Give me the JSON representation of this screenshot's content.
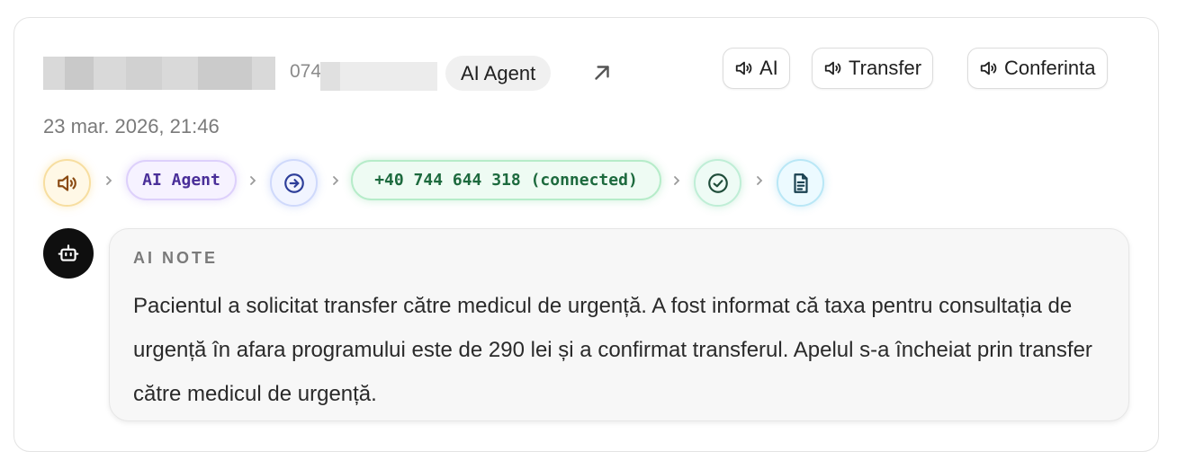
{
  "header": {
    "phone_prefix": "074",
    "agent_label": "AI Agent",
    "external_link_icon": "arrow-up-right-icon",
    "audio_buttons": [
      {
        "label": "AI",
        "icon": "speaker-icon"
      },
      {
        "label": "Transfer",
        "icon": "speaker-icon"
      },
      {
        "label": "Conferinta",
        "icon": "speaker-icon"
      }
    ]
  },
  "date": "23 mar. 2026, 21:46",
  "flow": {
    "steps": [
      {
        "kind": "icon",
        "icon": "speaker-icon",
        "color": "#b06a10"
      },
      {
        "kind": "pill",
        "label": "AI Agent",
        "color": "#4a2f99"
      },
      {
        "kind": "icon",
        "icon": "arrow-right-circle-icon",
        "color": "#3b4fb8"
      },
      {
        "kind": "pill",
        "label": "+40 744 644 318 (connected)",
        "color": "#1d6a3e"
      },
      {
        "kind": "icon",
        "icon": "check-circle-icon",
        "color": "#1f5a44"
      },
      {
        "kind": "icon",
        "icon": "document-icon",
        "color": "#1a4d5c"
      }
    ]
  },
  "note": {
    "avatar_icon": "robot-icon",
    "label": "AI NOTE",
    "text": "Pacientul a solicitat transfer către medicul de urgență. A fost informat că taxa pentru consultația de urgență în afara programului este de 290 lei și a confirmat transferul. Apelul s-a încheiat prin transfer către medicul de urgență."
  }
}
